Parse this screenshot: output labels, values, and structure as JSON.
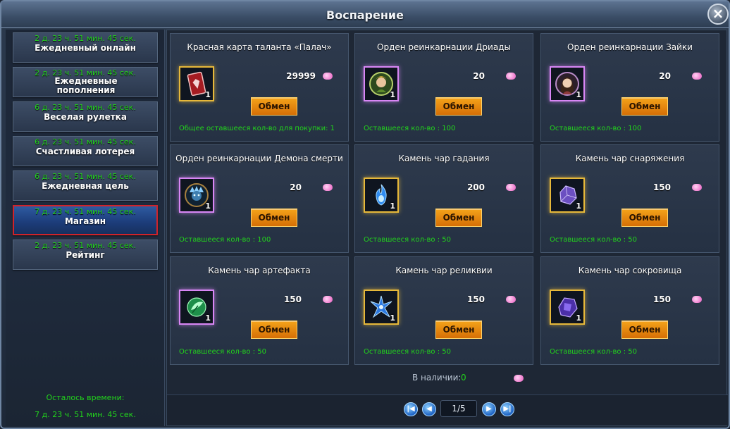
{
  "window": {
    "title": "Воспарение",
    "close_icon": "×"
  },
  "sidebar": {
    "items": [
      {
        "timer": "2 д. 23 ч. 51 мин. 45 сек.",
        "label": "Ежедневный онлайн",
        "active": false
      },
      {
        "timer": "2 д. 23 ч. 51 мин. 45 сек.",
        "label": "Ежедневные пополнения",
        "active": false
      },
      {
        "timer": "6 д. 23 ч. 51 мин. 45 сек.",
        "label": "Веселая рулетка",
        "active": false
      },
      {
        "timer": "6 д. 23 ч. 51 мин. 45 сек.",
        "label": "Счастливая лотерея",
        "active": false
      },
      {
        "timer": "6 д. 23 ч. 51 мин. 45 сек.",
        "label": "Ежедневная цель",
        "active": false
      },
      {
        "timer": "7 д. 23 ч. 51 мин. 45 сек.",
        "label": "Магазин",
        "active": true
      },
      {
        "timer": "2 д. 23 ч. 51 мин. 45 сек.",
        "label": "Рейтинг",
        "active": false
      }
    ],
    "footer_label": "Осталось времени:",
    "footer_time": "7 д. 23 ч. 51 мин. 45 сек."
  },
  "shop": {
    "items": [
      {
        "title": "Красная карта таланта «Палач»",
        "icon": "red-card-icon",
        "frame": "gold",
        "qty": "1",
        "price": "29999",
        "button": "Обмен",
        "remaining": "Общее оставшееся кол-во для покупки: 1"
      },
      {
        "title": "Орден реинкарнации Дриады",
        "icon": "dryad-portrait-icon",
        "frame": "purple",
        "qty": "1",
        "price": "20",
        "button": "Обмен",
        "remaining": "Оставшееся кол-во : 100"
      },
      {
        "title": "Орден реинкарнации Зайки",
        "icon": "bunny-portrait-icon",
        "frame": "purple",
        "qty": "1",
        "price": "20",
        "button": "Обмен",
        "remaining": "Оставшееся кол-во : 100"
      },
      {
        "title": "Орден реинкарнации Демона смерти",
        "icon": "death-demon-portrait-icon",
        "frame": "purple",
        "qty": "1",
        "price": "20",
        "button": "Обмен",
        "remaining": "Оставшееся кол-во : 100"
      },
      {
        "title": "Камень чар гадания",
        "icon": "blue-flame-stone-icon",
        "frame": "gold",
        "qty": "1",
        "price": "200",
        "button": "Обмен",
        "remaining": "Оставшееся кол-во : 50"
      },
      {
        "title": "Камень чар снаряжения",
        "icon": "purple-crystal-icon",
        "frame": "gold",
        "qty": "1",
        "price": "150",
        "button": "Обмен",
        "remaining": "Оставшееся кол-во : 50"
      },
      {
        "title": "Камень чар артефакта",
        "icon": "green-leaf-stone-icon",
        "frame": "purple",
        "qty": "1",
        "price": "150",
        "button": "Обмен",
        "remaining": "Оставшееся кол-во : 50"
      },
      {
        "title": "Камень чар реликвии",
        "icon": "blue-star-stone-icon",
        "frame": "gold",
        "qty": "1",
        "price": "150",
        "button": "Обмен",
        "remaining": "Оставшееся кол-во : 50"
      },
      {
        "title": "Камень чар сокровища",
        "icon": "violet-gem-stone-icon",
        "frame": "gold",
        "qty": "1",
        "price": "150",
        "button": "Обмен",
        "remaining": "Оставшееся кол-во : 50"
      }
    ],
    "stock_label": "В наличии:",
    "stock_value": "0",
    "currency_icon": "pink-gem-icon"
  },
  "pager": {
    "display": "1/5"
  },
  "colors": {
    "timer_green": "#22d31c",
    "button_orange": "#f4a31a",
    "active_border": "#d0232a"
  }
}
